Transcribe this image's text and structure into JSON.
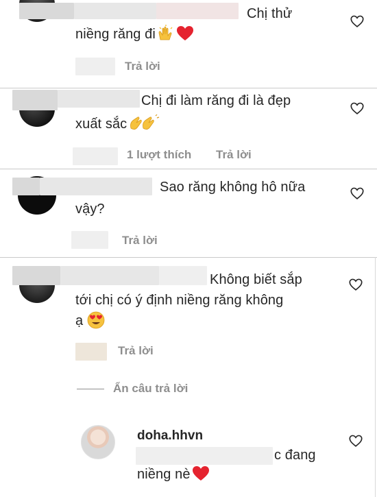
{
  "comments": [
    {
      "text_line1": "Chị thử",
      "text_line2": "niềng răng đi",
      "emojis": [
        "raising-hands",
        "red-heart"
      ],
      "meta": {
        "likes": "",
        "reply": "Trả lời"
      }
    },
    {
      "text_line1": "Chị đi làm răng đi là đẹp",
      "text_line2": "xuất sắc",
      "emojis": [
        "clapping-hands"
      ],
      "meta": {
        "likes": "1 lượt thích",
        "reply": "Trả lời"
      }
    },
    {
      "text_line1": "Sao răng không hô nữa",
      "text_line2": "vậy?",
      "emojis": [],
      "meta": {
        "likes": "",
        "reply": "Trả lời"
      }
    },
    {
      "text_line1": "Không biết sắp",
      "text_line2": "tới chị có ý định niềng răng không",
      "text_line3": "ạ",
      "emojis": [
        "heart-eyes"
      ],
      "meta": {
        "likes": "",
        "reply": "Trả lời"
      }
    }
  ],
  "hide_replies_label": "Ẩn câu trả lời",
  "reply": {
    "username": "doha.hhvn",
    "text_line1": "c đang",
    "text_line2": "niềng nè",
    "emojis": [
      "red-heart"
    ]
  },
  "colors": {
    "text": "#262626",
    "secondary": "#8e8e8e",
    "heart": "#e5232f",
    "divider": "#c9c9c9"
  }
}
